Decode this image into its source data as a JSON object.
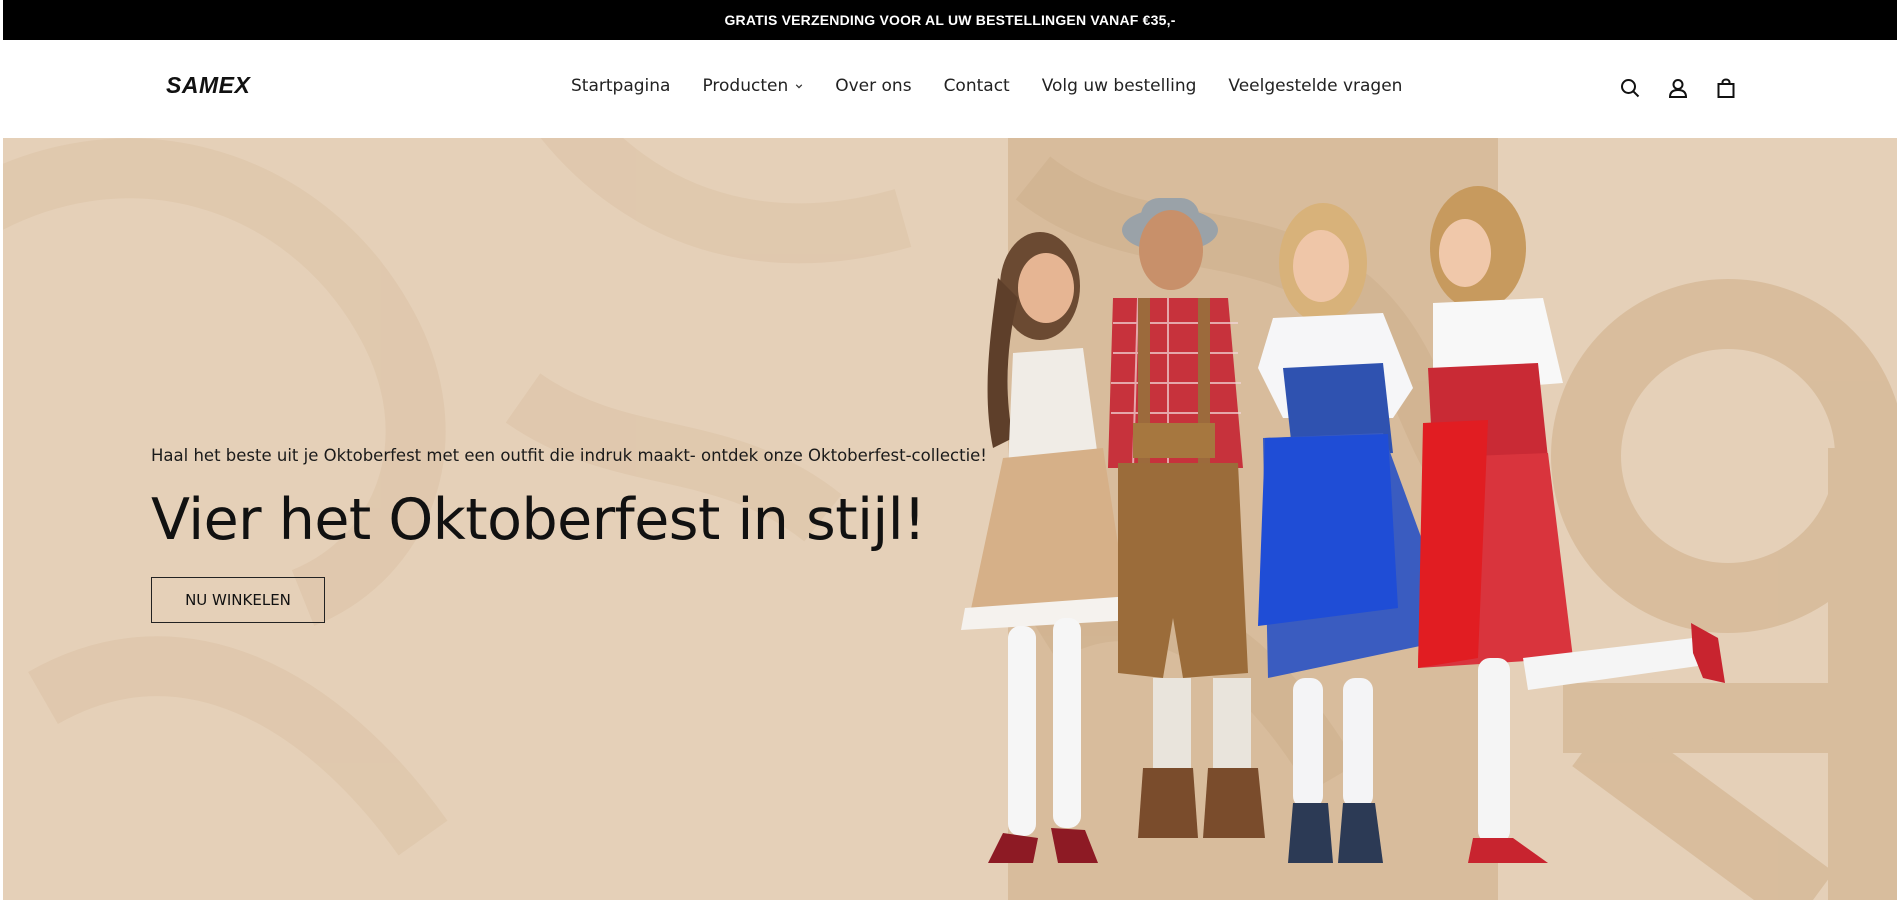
{
  "announcement": {
    "text": "GRATIS VERZENDING VOOR AL UW BESTELLINGEN VANAF €35,-"
  },
  "header": {
    "logo": "SAMEX",
    "nav": [
      {
        "label": "Startpagina"
      },
      {
        "label": "Producten",
        "has_dropdown": true
      },
      {
        "label": "Over ons"
      },
      {
        "label": "Contact"
      },
      {
        "label": "Volg uw bestelling"
      },
      {
        "label": "Veelgestelde vragen"
      }
    ],
    "icons": [
      "search-icon",
      "account-icon",
      "cart-icon"
    ]
  },
  "hero": {
    "subtitle": "Haal het beste uit je Oktoberfest met een outfit die indruk maakt- ontdek onze Oktoberfest-collectie!",
    "title": "Vier het Oktoberfest in stijl!",
    "cta": "NU WINKELEN",
    "colors": {
      "background": "#e4cfb7",
      "panel": "#d7bb9b",
      "accent_red": "#d81f26",
      "accent_blue": "#2b4fb3"
    }
  }
}
